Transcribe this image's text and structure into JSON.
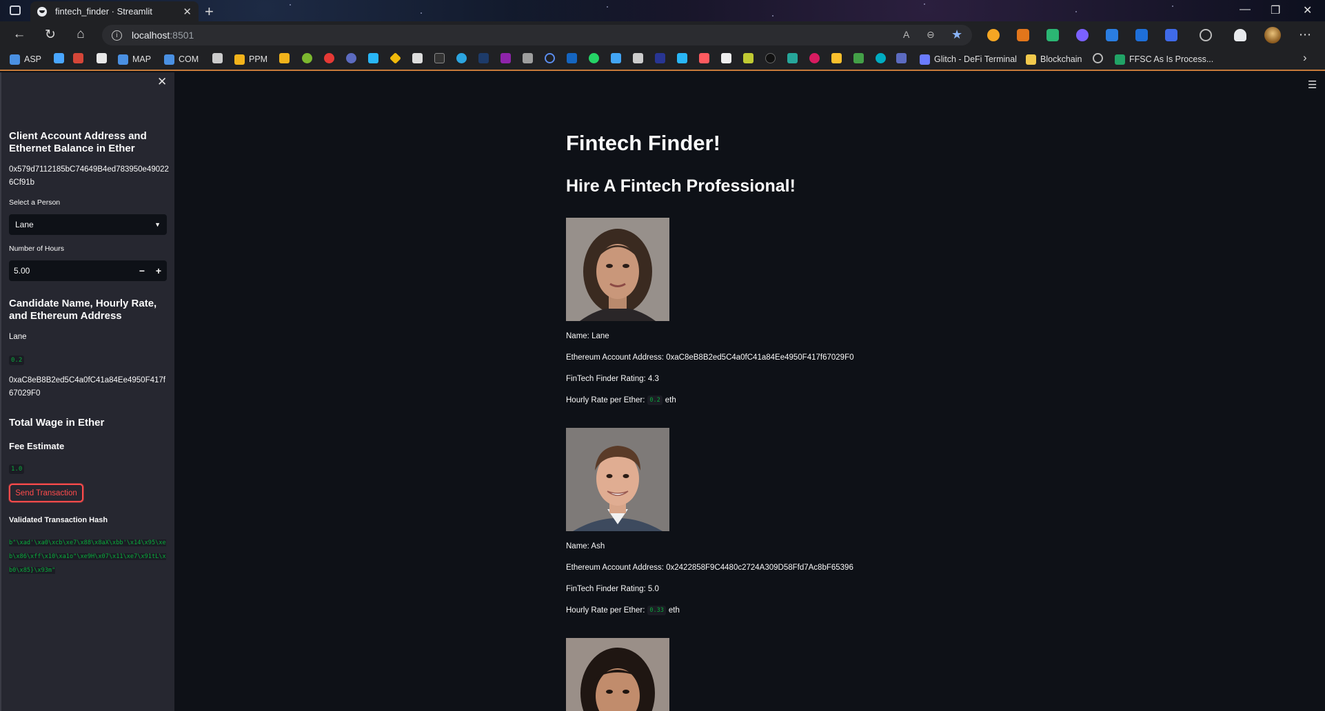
{
  "browser": {
    "tab_title": "fintech_finder · Streamlit",
    "tab_close": "✕",
    "new_tab": "+",
    "url_host": "localhost",
    "url_port": ":8501",
    "window_controls": [
      "—",
      "❐",
      "✕"
    ],
    "bookmarks": [
      {
        "label": "ASP",
        "color": "#4a90e2"
      },
      {
        "label": "MAP",
        "color": "#4a90e2"
      },
      {
        "label": "COM",
        "color": "#4a90e2"
      },
      {
        "label": "PPM",
        "color": "#f2b31b"
      },
      {
        "label": "Glitch - DeFi Terminal",
        "color": "#6a7bff"
      },
      {
        "label": "Blockchain",
        "color": "#f2c94c"
      },
      {
        "label": "FFSC As Is Process...",
        "color": "#21a366"
      }
    ]
  },
  "sidebar": {
    "close_icon": "✕",
    "account_header": "Client Account Address and Ethernet Balance in Ether",
    "account_address": "0x579d7112185bC74649B4ed783950e490226Cf91b",
    "select_label": "Select a Person",
    "select_value": "Lane",
    "hours_label": "Number of Hours",
    "hours_value": "5.00",
    "minus": "−",
    "plus": "+",
    "candidate_header": "Candidate Name, Hourly Rate, and Ethereum Address",
    "candidate_name": "Lane",
    "candidate_rate": "0.2",
    "candidate_address": "0xaC8eB8B2ed5C4a0fC41a84Ee4950F417f67029F0",
    "total_wage_header": "Total Wage in Ether",
    "fee_label": "Fee Estimate",
    "fee_value": "1.0",
    "send_button": "Send Transaction",
    "hash_label": "Validated Transaction Hash",
    "hash_value": "b\"\\xad'\\xa0\\xcb\\xe7\\x88\\x8aX\\xbb'\\x14\\x95\\xeb\\x86\\xff\\x10\\xa1o\"\\xe9H\\x07\\x11\\xe7\\x91tL\\xb0\\x85}\\x93m\""
  },
  "main": {
    "menu_icon": "☰",
    "title": "Fintech Finder!",
    "subtitle": "Hire A Fintech Professional!",
    "candidates": [
      {
        "name_line": "Name: Lane",
        "address_line": "Ethereum Account Address: 0xaC8eB8B2ed5C4a0fC41a84Ee4950F417f67029F0",
        "rating_line": "FinTech Finder Rating: 4.3",
        "rate_prefix": "Hourly Rate per Ether:",
        "rate_value": "0.2",
        "rate_suffix": "eth"
      },
      {
        "name_line": "Name: Ash",
        "address_line": "Ethereum Account Address: 0x2422858F9C4480c2724A309D58Ffd7Ac8bF65396",
        "rating_line": "FinTech Finder Rating: 5.0",
        "rate_prefix": "Hourly Rate per Ether:",
        "rate_value": "0.33",
        "rate_suffix": "eth"
      }
    ]
  }
}
